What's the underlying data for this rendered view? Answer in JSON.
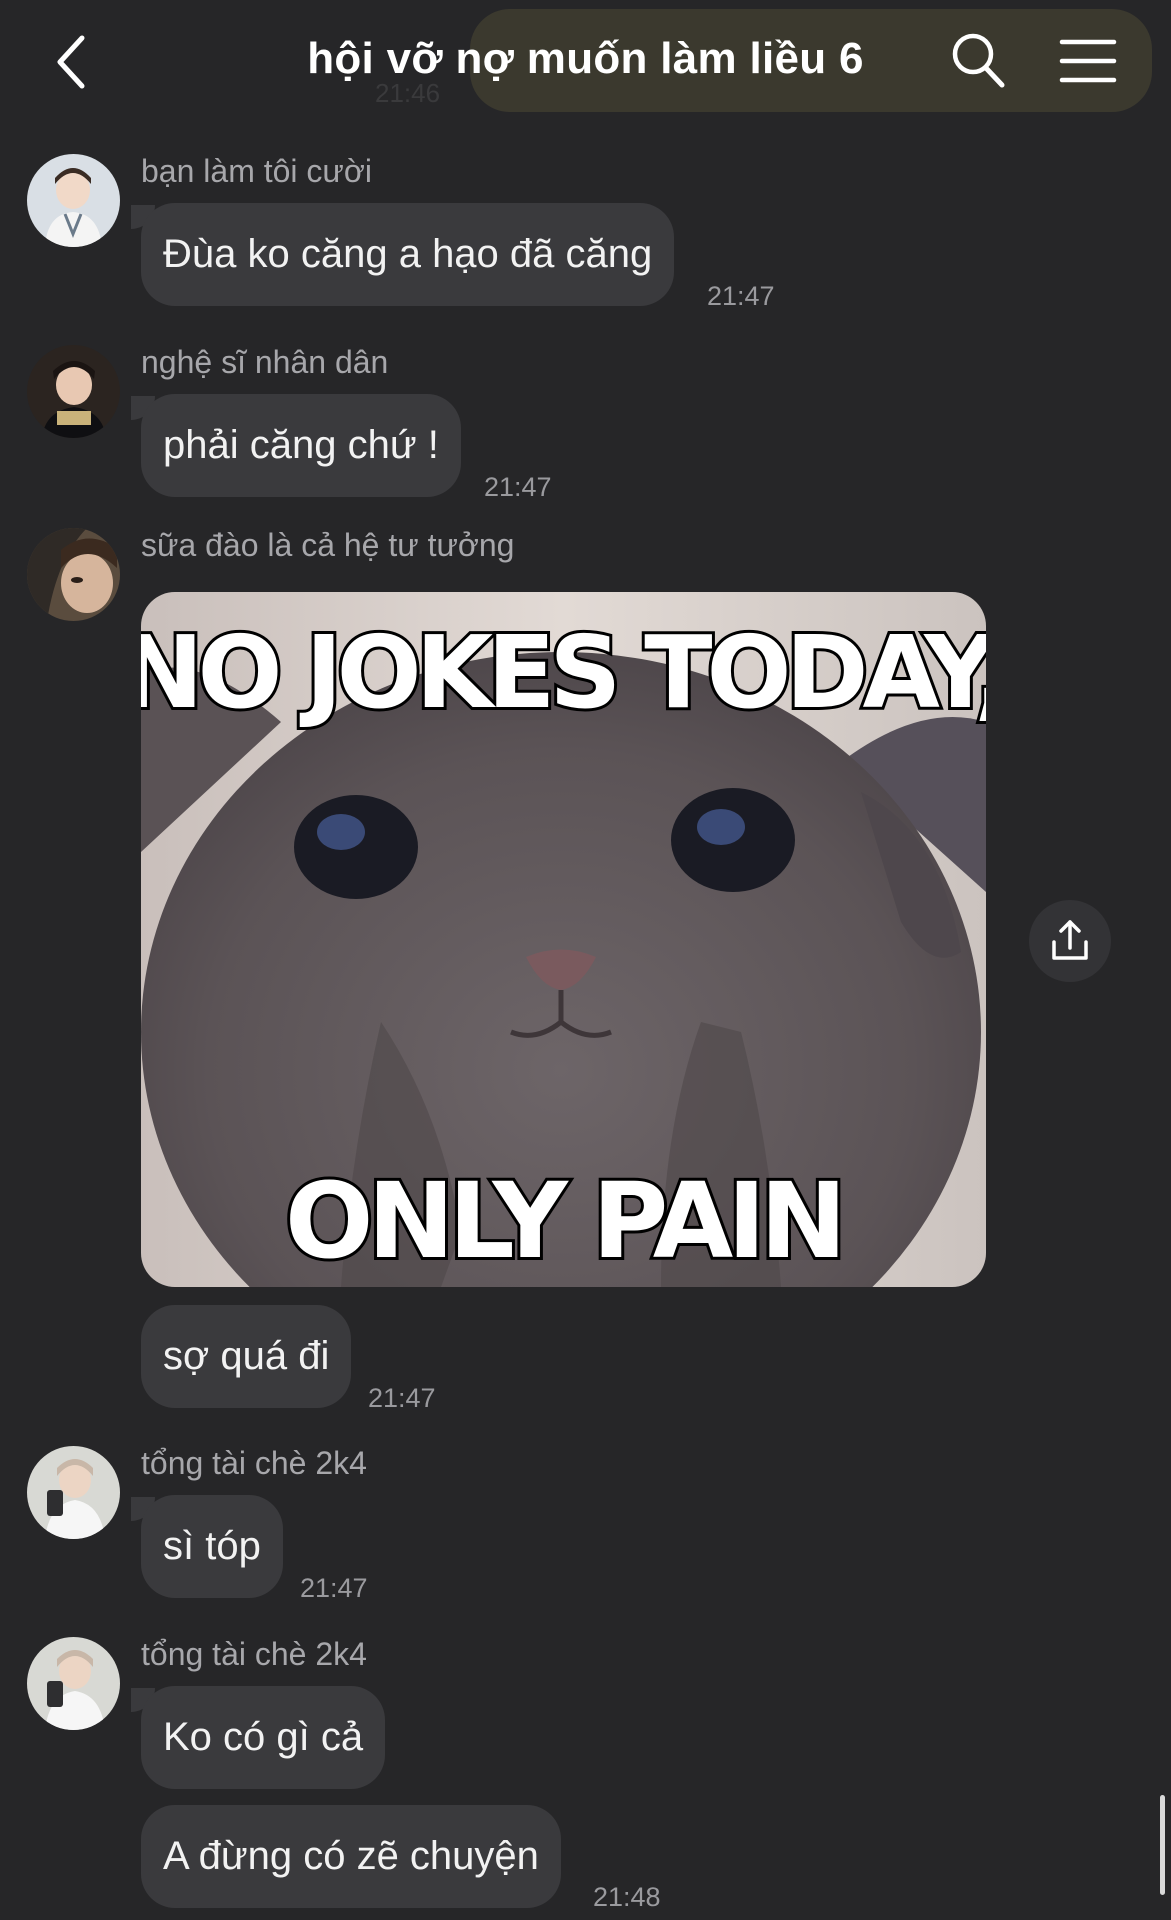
{
  "header": {
    "title": "hội vỡ nợ muốn làm liều 6",
    "ghost_time": "21:46",
    "icons": [
      "chevron-left-icon",
      "search-icon",
      "hamburger-menu-icon"
    ],
    "pill_color": "#3b392e"
  },
  "messages": [
    {
      "sender": "bạn làm tôi cười",
      "text": "Đùa ko căng a hạo đã căng",
      "time": "21:47"
    },
    {
      "sender": "nghệ sĩ nhân dân",
      "text": "phải căng chứ !",
      "time": "21:47"
    },
    {
      "sender": "sữa đào là cả hệ tư tưởng",
      "image": {
        "top_text": "NO JOKES TODAY,",
        "bottom_text": "ONLY PAIN"
      }
    },
    {
      "text": "sợ quá đi",
      "time": "21:47"
    },
    {
      "sender": "tổng tài chè 2k4",
      "text": "sì tóp",
      "time": "21:47"
    },
    {
      "sender": "tổng tài chè 2k4",
      "text": "Ko có gì cả"
    },
    {
      "text": "A đừng có zẽ chuyện",
      "time": "21:48"
    }
  ],
  "colors": {
    "background": "#262628",
    "bubble": "#3a3a3d",
    "sender": "#a7a7ab",
    "time": "#9a9a9e"
  }
}
